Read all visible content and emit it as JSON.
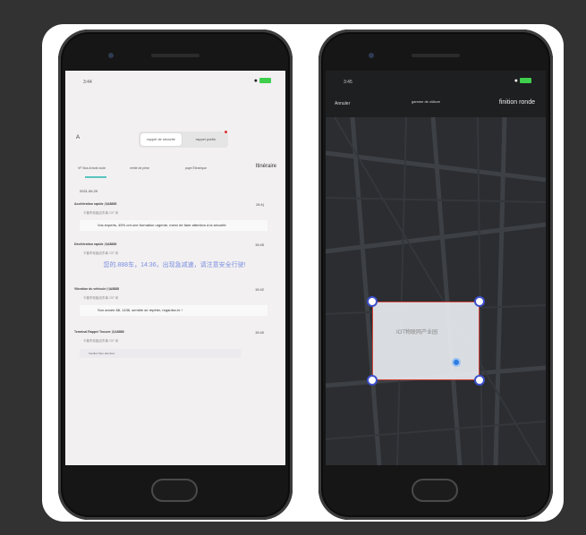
{
  "left_phone": {
    "status": {
      "time": "3:44"
    },
    "back_label": "A",
    "segment": {
      "active": "rappel de sécurité",
      "inactive": "rappel public"
    },
    "tabs": [
      "VF Bus Arrival route",
      "vérité de prise",
      "paye Électrique"
    ],
    "directory_label": "Itinéraire",
    "date": "2021.06.29",
    "cards": [
      {
        "title": "Accélération rapide 川A8888",
        "time": "15:4(",
        "sub": "卡普车轮胎店东南 137 米",
        "message": "Vos experts, 45% ont une formation urgente, merci de faire attention à la sécurité"
      },
      {
        "title": "Décélération rapide 川A8888",
        "time": "15:45",
        "sub": "卡普车轮胎店东南 137 米",
        "message": "您的.888车，14:36，出现急减速，请注意安全行驶!"
      },
      {
        "title": "Vibration du véhicule 川A8888",
        "time": "15:42",
        "sub": "卡普车轮胎店东南 137 米",
        "message": "Son année 88, 1436, semble se répéter, regardez-le !"
      },
      {
        "title": "Terminal Rappel Trouver 川A8888",
        "time": "15:40",
        "sub": "卡普车轮胎店东南 137 米",
        "message": "Veuillez faire attention"
      }
    ]
  },
  "right_phone": {
    "status": {
      "time": "3:45"
    },
    "cancel_label": "Annuler",
    "range_label": "gamme de clôture",
    "finish_label": "finition ronde",
    "selection_label": "IOT物联网产业园"
  }
}
